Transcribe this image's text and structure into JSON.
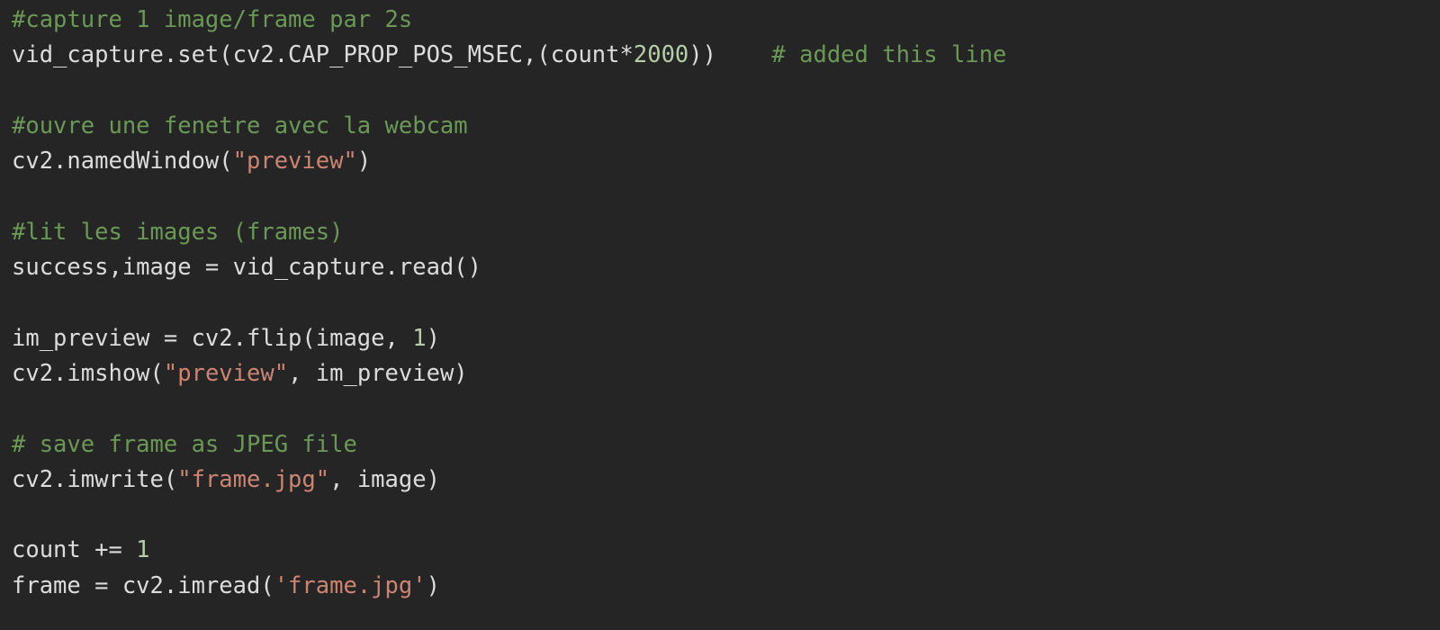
{
  "editor": {
    "language": "python",
    "background_color": "#252526",
    "colors": {
      "plain_text": "#dcdcdc",
      "comment": "#6a9955",
      "string": "#cd8571",
      "number": "#b5cea8"
    },
    "lines": [
      {
        "index": 1,
        "text": "#capture 1 image/frame par 2s",
        "tokens": [
          {
            "t": "#capture 1 image/frame par 2s",
            "k": "comment"
          }
        ]
      },
      {
        "index": 2,
        "text": "vid_capture.set(cv2.CAP_PROP_POS_MSEC,(count*2000))    # added this line",
        "tokens": [
          {
            "t": "vid_capture.set(cv2.CAP_PROP_POS_MSEC,(count*",
            "k": "plain"
          },
          {
            "t": "2000",
            "k": "number"
          },
          {
            "t": "))",
            "k": "plain"
          },
          {
            "t": "    ",
            "k": "plain"
          },
          {
            "t": "# added this line",
            "k": "comment"
          }
        ]
      },
      {
        "index": 3,
        "text": "",
        "tokens": []
      },
      {
        "index": 4,
        "text": "#ouvre une fenetre avec la webcam",
        "tokens": [
          {
            "t": "#ouvre une fenetre avec la webcam",
            "k": "comment"
          }
        ]
      },
      {
        "index": 5,
        "text": "cv2.namedWindow(\"preview\")",
        "tokens": [
          {
            "t": "cv2.namedWindow(",
            "k": "plain"
          },
          {
            "t": "\"preview\"",
            "k": "string"
          },
          {
            "t": ")",
            "k": "plain"
          }
        ]
      },
      {
        "index": 6,
        "text": "",
        "tokens": []
      },
      {
        "index": 7,
        "text": "#lit les images (frames)",
        "tokens": [
          {
            "t": "#lit les images (frames)",
            "k": "comment"
          }
        ]
      },
      {
        "index": 8,
        "text": "success,image = vid_capture.read()",
        "tokens": [
          {
            "t": "success,image = vid_capture.read()",
            "k": "plain"
          }
        ]
      },
      {
        "index": 9,
        "text": "",
        "tokens": []
      },
      {
        "index": 10,
        "text": "im_preview = cv2.flip(image, 1)",
        "tokens": [
          {
            "t": "im_preview = cv2.flip(image, ",
            "k": "plain"
          },
          {
            "t": "1",
            "k": "number"
          },
          {
            "t": ")",
            "k": "plain"
          }
        ]
      },
      {
        "index": 11,
        "text": "cv2.imshow(\"preview\", im_preview)",
        "tokens": [
          {
            "t": "cv2.imshow(",
            "k": "plain"
          },
          {
            "t": "\"preview\"",
            "k": "string"
          },
          {
            "t": ", im_preview)",
            "k": "plain"
          }
        ]
      },
      {
        "index": 12,
        "text": "",
        "tokens": []
      },
      {
        "index": 13,
        "text": "# save frame as JPEG file",
        "tokens": [
          {
            "t": "# save frame as JPEG file",
            "k": "comment"
          }
        ]
      },
      {
        "index": 14,
        "text": "cv2.imwrite(\"frame.jpg\", image)",
        "tokens": [
          {
            "t": "cv2.imwrite(",
            "k": "plain"
          },
          {
            "t": "\"frame.jpg\"",
            "k": "string"
          },
          {
            "t": ", image)",
            "k": "plain"
          }
        ]
      },
      {
        "index": 15,
        "text": "",
        "tokens": []
      },
      {
        "index": 16,
        "text": "count += 1",
        "tokens": [
          {
            "t": "count += ",
            "k": "plain"
          },
          {
            "t": "1",
            "k": "number"
          }
        ]
      },
      {
        "index": 17,
        "text": "frame = cv2.imread('frame.jpg')",
        "tokens": [
          {
            "t": "frame = cv2.imread(",
            "k": "plain"
          },
          {
            "t": "'frame.jpg'",
            "k": "string"
          },
          {
            "t": ")",
            "k": "plain"
          }
        ]
      }
    ]
  }
}
